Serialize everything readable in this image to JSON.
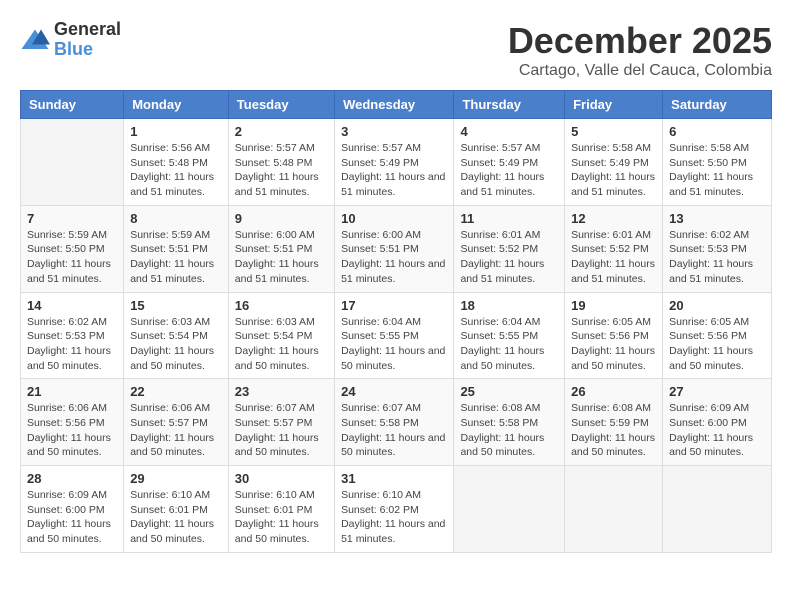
{
  "header": {
    "logo_general": "General",
    "logo_blue": "Blue",
    "month_title": "December 2025",
    "location": "Cartago, Valle del Cauca, Colombia"
  },
  "days_of_week": [
    "Sunday",
    "Monday",
    "Tuesday",
    "Wednesday",
    "Thursday",
    "Friday",
    "Saturday"
  ],
  "weeks": [
    [
      {
        "day": "",
        "info": ""
      },
      {
        "day": "1",
        "info": "Sunrise: 5:56 AM\nSunset: 5:48 PM\nDaylight: 11 hours and 51 minutes."
      },
      {
        "day": "2",
        "info": "Sunrise: 5:57 AM\nSunset: 5:48 PM\nDaylight: 11 hours and 51 minutes."
      },
      {
        "day": "3",
        "info": "Sunrise: 5:57 AM\nSunset: 5:49 PM\nDaylight: 11 hours and 51 minutes."
      },
      {
        "day": "4",
        "info": "Sunrise: 5:57 AM\nSunset: 5:49 PM\nDaylight: 11 hours and 51 minutes."
      },
      {
        "day": "5",
        "info": "Sunrise: 5:58 AM\nSunset: 5:49 PM\nDaylight: 11 hours and 51 minutes."
      },
      {
        "day": "6",
        "info": "Sunrise: 5:58 AM\nSunset: 5:50 PM\nDaylight: 11 hours and 51 minutes."
      }
    ],
    [
      {
        "day": "7",
        "info": "Sunrise: 5:59 AM\nSunset: 5:50 PM\nDaylight: 11 hours and 51 minutes."
      },
      {
        "day": "8",
        "info": "Sunrise: 5:59 AM\nSunset: 5:51 PM\nDaylight: 11 hours and 51 minutes."
      },
      {
        "day": "9",
        "info": "Sunrise: 6:00 AM\nSunset: 5:51 PM\nDaylight: 11 hours and 51 minutes."
      },
      {
        "day": "10",
        "info": "Sunrise: 6:00 AM\nSunset: 5:51 PM\nDaylight: 11 hours and 51 minutes."
      },
      {
        "day": "11",
        "info": "Sunrise: 6:01 AM\nSunset: 5:52 PM\nDaylight: 11 hours and 51 minutes."
      },
      {
        "day": "12",
        "info": "Sunrise: 6:01 AM\nSunset: 5:52 PM\nDaylight: 11 hours and 51 minutes."
      },
      {
        "day": "13",
        "info": "Sunrise: 6:02 AM\nSunset: 5:53 PM\nDaylight: 11 hours and 51 minutes."
      }
    ],
    [
      {
        "day": "14",
        "info": "Sunrise: 6:02 AM\nSunset: 5:53 PM\nDaylight: 11 hours and 50 minutes."
      },
      {
        "day": "15",
        "info": "Sunrise: 6:03 AM\nSunset: 5:54 PM\nDaylight: 11 hours and 50 minutes."
      },
      {
        "day": "16",
        "info": "Sunrise: 6:03 AM\nSunset: 5:54 PM\nDaylight: 11 hours and 50 minutes."
      },
      {
        "day": "17",
        "info": "Sunrise: 6:04 AM\nSunset: 5:55 PM\nDaylight: 11 hours and 50 minutes."
      },
      {
        "day": "18",
        "info": "Sunrise: 6:04 AM\nSunset: 5:55 PM\nDaylight: 11 hours and 50 minutes."
      },
      {
        "day": "19",
        "info": "Sunrise: 6:05 AM\nSunset: 5:56 PM\nDaylight: 11 hours and 50 minutes."
      },
      {
        "day": "20",
        "info": "Sunrise: 6:05 AM\nSunset: 5:56 PM\nDaylight: 11 hours and 50 minutes."
      }
    ],
    [
      {
        "day": "21",
        "info": "Sunrise: 6:06 AM\nSunset: 5:56 PM\nDaylight: 11 hours and 50 minutes."
      },
      {
        "day": "22",
        "info": "Sunrise: 6:06 AM\nSunset: 5:57 PM\nDaylight: 11 hours and 50 minutes."
      },
      {
        "day": "23",
        "info": "Sunrise: 6:07 AM\nSunset: 5:57 PM\nDaylight: 11 hours and 50 minutes."
      },
      {
        "day": "24",
        "info": "Sunrise: 6:07 AM\nSunset: 5:58 PM\nDaylight: 11 hours and 50 minutes."
      },
      {
        "day": "25",
        "info": "Sunrise: 6:08 AM\nSunset: 5:58 PM\nDaylight: 11 hours and 50 minutes."
      },
      {
        "day": "26",
        "info": "Sunrise: 6:08 AM\nSunset: 5:59 PM\nDaylight: 11 hours and 50 minutes."
      },
      {
        "day": "27",
        "info": "Sunrise: 6:09 AM\nSunset: 6:00 PM\nDaylight: 11 hours and 50 minutes."
      }
    ],
    [
      {
        "day": "28",
        "info": "Sunrise: 6:09 AM\nSunset: 6:00 PM\nDaylight: 11 hours and 50 minutes."
      },
      {
        "day": "29",
        "info": "Sunrise: 6:10 AM\nSunset: 6:01 PM\nDaylight: 11 hours and 50 minutes."
      },
      {
        "day": "30",
        "info": "Sunrise: 6:10 AM\nSunset: 6:01 PM\nDaylight: 11 hours and 50 minutes."
      },
      {
        "day": "31",
        "info": "Sunrise: 6:10 AM\nSunset: 6:02 PM\nDaylight: 11 hours and 51 minutes."
      },
      {
        "day": "",
        "info": ""
      },
      {
        "day": "",
        "info": ""
      },
      {
        "day": "",
        "info": ""
      }
    ]
  ]
}
